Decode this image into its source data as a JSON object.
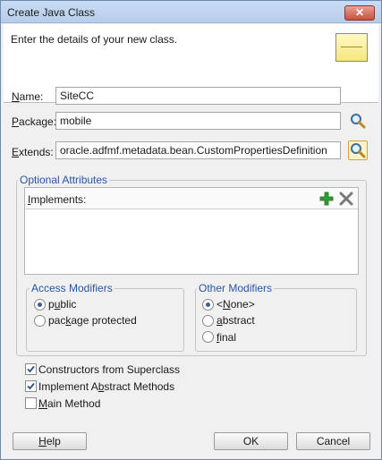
{
  "window": {
    "title": "Create Java Class",
    "close_glyph": "✕"
  },
  "header": {
    "description": "Enter the details of your new class.",
    "icon": "java-class-icon"
  },
  "form": {
    "name": {
      "label_u": "N",
      "label_rest": "ame:",
      "value": "SiteCC"
    },
    "package": {
      "label_u": "P",
      "label_rest": "ackage:",
      "value": "mobile"
    },
    "extends": {
      "label_u": "E",
      "label_rest": "xtends:",
      "value": "oracle.adfmf.metadata.bean.CustomPropertiesDefinition"
    }
  },
  "optional": {
    "title": "Optional Attributes",
    "implements_u": "I",
    "implements_rest": "mplements:"
  },
  "access": {
    "title": "Access Modifiers",
    "public_pre": "p",
    "public_u": "u",
    "public_post": "blic",
    "protected_pre": "pac",
    "protected_u": "k",
    "protected_post": "age protected",
    "selected": "public"
  },
  "other": {
    "title": "Other Modifiers",
    "none_pre": "<",
    "none_u": "N",
    "none_post": "one>",
    "abstract_u": "a",
    "abstract_post": "bstract",
    "final_u": "f",
    "final_post": "inal",
    "selected": "<None>"
  },
  "checks": {
    "constructors": {
      "label": "Constructors from Superclass",
      "checked": true
    },
    "abstract_methods": {
      "pre": "Implement A",
      "u": "b",
      "post": "stract Methods",
      "checked": true
    },
    "main": {
      "u": "M",
      "post": "ain Method",
      "checked": false
    }
  },
  "buttons": {
    "help_u": "H",
    "help_post": "elp",
    "ok": "OK",
    "cancel": "Cancel"
  },
  "colors": {
    "accent": "#2855a0",
    "add": "#2f9d2f",
    "remove": "#7a7a7a"
  }
}
